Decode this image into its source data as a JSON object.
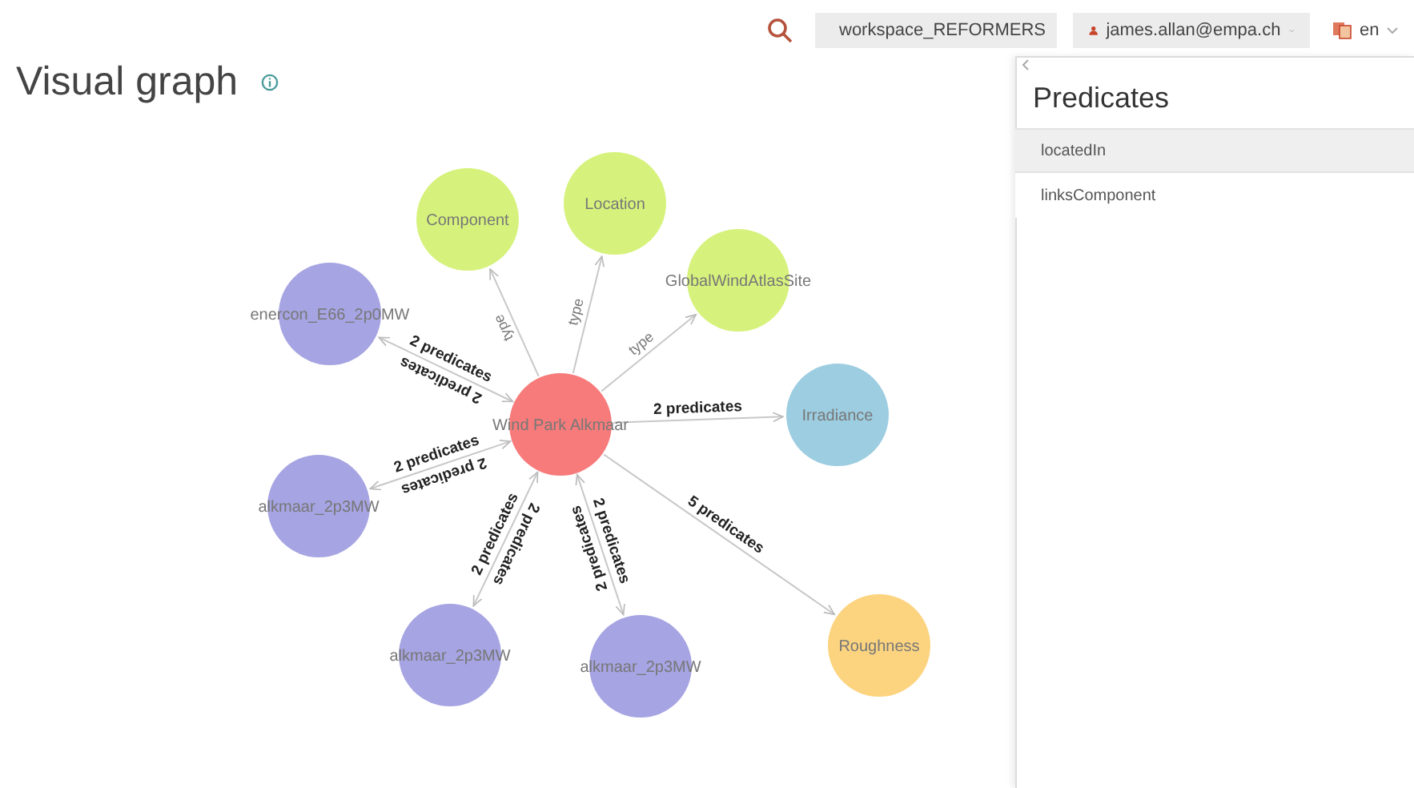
{
  "header": {
    "workspace": "workspace_REFORMERS",
    "user": "james.allan@empa.ch",
    "language": "en"
  },
  "title": "Visual graph",
  "graph": {
    "nodes": [
      {
        "label": "Wind Park Alkmaar",
        "color": "#f77b7b",
        "kind": "center"
      },
      {
        "label": "Component",
        "color": "#d6f27c",
        "kind": "neighbor",
        "link": {
          "outgoing": "type"
        }
      },
      {
        "label": "Location",
        "color": "#d6f27c",
        "kind": "neighbor",
        "link": {
          "outgoing": "type"
        }
      },
      {
        "label": "GlobalWindAtlasSite",
        "color": "#d6f27c",
        "kind": "neighbor",
        "link": {
          "outgoing": "type"
        }
      },
      {
        "label": "enercon_E66_2p0MW",
        "color": "#a6a4e2",
        "kind": "neighbor",
        "link": {
          "outgoing": "2 predicates",
          "incoming": "2 predicates"
        }
      },
      {
        "label": "Irradiance",
        "color": "#9dcde0",
        "kind": "neighbor",
        "link": {
          "outgoing": "2 predicates"
        }
      },
      {
        "label": "alkmaar_2p3MW",
        "color": "#a6a4e2",
        "kind": "neighbor",
        "link": {
          "outgoing": "2 predicates",
          "incoming": "2 predicates"
        }
      },
      {
        "label": "alkmaar_2p3MW",
        "color": "#a6a4e2",
        "kind": "neighbor",
        "link": {
          "outgoing": "2 predicates",
          "incoming": "2 predicates"
        }
      },
      {
        "label": "alkmaar_2p3MW",
        "color": "#a6a4e2",
        "kind": "neighbor",
        "link": {
          "outgoing": "2 predicates",
          "incoming": "2 predicates"
        }
      },
      {
        "label": "Roughness",
        "color": "#fcd480",
        "kind": "neighbor",
        "link": {
          "outgoing": "5 predicates"
        }
      }
    ]
  },
  "panel": {
    "title": "Predicates",
    "items": [
      {
        "label": "locatedIn",
        "selected": true
      },
      {
        "label": "linksComponent",
        "selected": false
      }
    ]
  }
}
